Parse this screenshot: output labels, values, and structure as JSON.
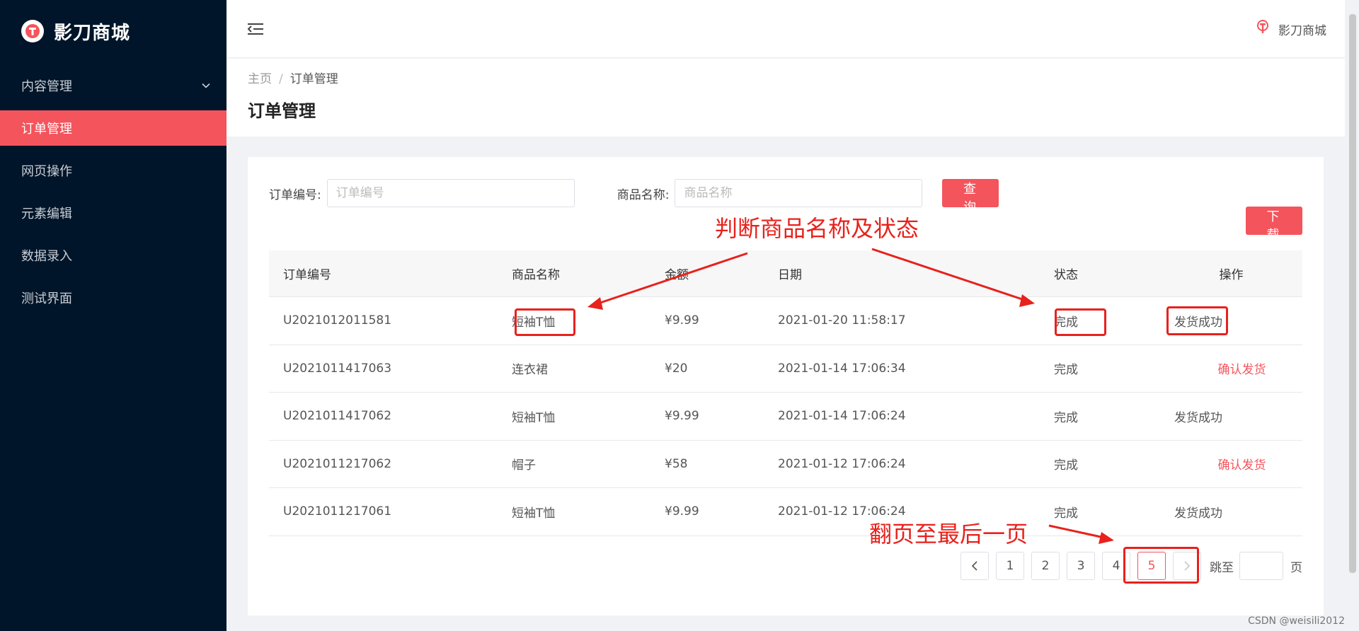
{
  "brand": {
    "title": "影刀商城"
  },
  "sidebar": {
    "items": [
      {
        "label": "内容管理"
      },
      {
        "label": "订单管理"
      },
      {
        "label": "网页操作"
      },
      {
        "label": "元素编辑"
      },
      {
        "label": "数据录入"
      },
      {
        "label": "测试界面"
      }
    ]
  },
  "header": {
    "user_label": "影刀商城"
  },
  "breadcrumb": {
    "home": "主页",
    "separator": "/",
    "current": "订单管理"
  },
  "page": {
    "title": "订单管理"
  },
  "filters": {
    "order_label": "订单编号:",
    "order_placeholder": "订单编号",
    "product_label": "商品名称:",
    "product_placeholder": "商品名称",
    "query_button": "查 询",
    "download_button": "下 载"
  },
  "table": {
    "headers": [
      "订单编号",
      "商品名称",
      "金额",
      "日期",
      "状态",
      "操作"
    ],
    "rows": [
      {
        "order_id": "U2021012011581",
        "product": "短袖T恤",
        "amount": "¥9.99",
        "date": "2021-01-20 11:58:17",
        "status": "完成",
        "action": "发货成功"
      },
      {
        "order_id": "U2021011417063",
        "product": "连衣裙",
        "amount": "¥20",
        "date": "2021-01-14 17:06:34",
        "status": "完成",
        "action": "确认发货"
      },
      {
        "order_id": "U2021011417062",
        "product": "短袖T恤",
        "amount": "¥9.99",
        "date": "2021-01-14 17:06:24",
        "status": "完成",
        "action": "发货成功"
      },
      {
        "order_id": "U2021011217062",
        "product": "帽子",
        "amount": "¥58",
        "date": "2021-01-12 17:06:24",
        "status": "完成",
        "action": "确认发货"
      },
      {
        "order_id": "U2021011217061",
        "product": "短袖T恤",
        "amount": "¥9.99",
        "date": "2021-01-12 17:06:24",
        "status": "完成",
        "action": "发货成功"
      }
    ]
  },
  "pagination": {
    "pages": [
      "1",
      "2",
      "3",
      "4",
      "5"
    ],
    "current": "5",
    "jump_label": "跳至",
    "page_suffix": "页"
  },
  "annotations": {
    "judge": "判断商品名称及状态",
    "last_page": "翻页至最后一页"
  },
  "watermark": "CSDN @weisili2012",
  "colors": {
    "accent": "#f4545c",
    "sidebar_bg": "#001529",
    "annotation": "#e8211c"
  }
}
